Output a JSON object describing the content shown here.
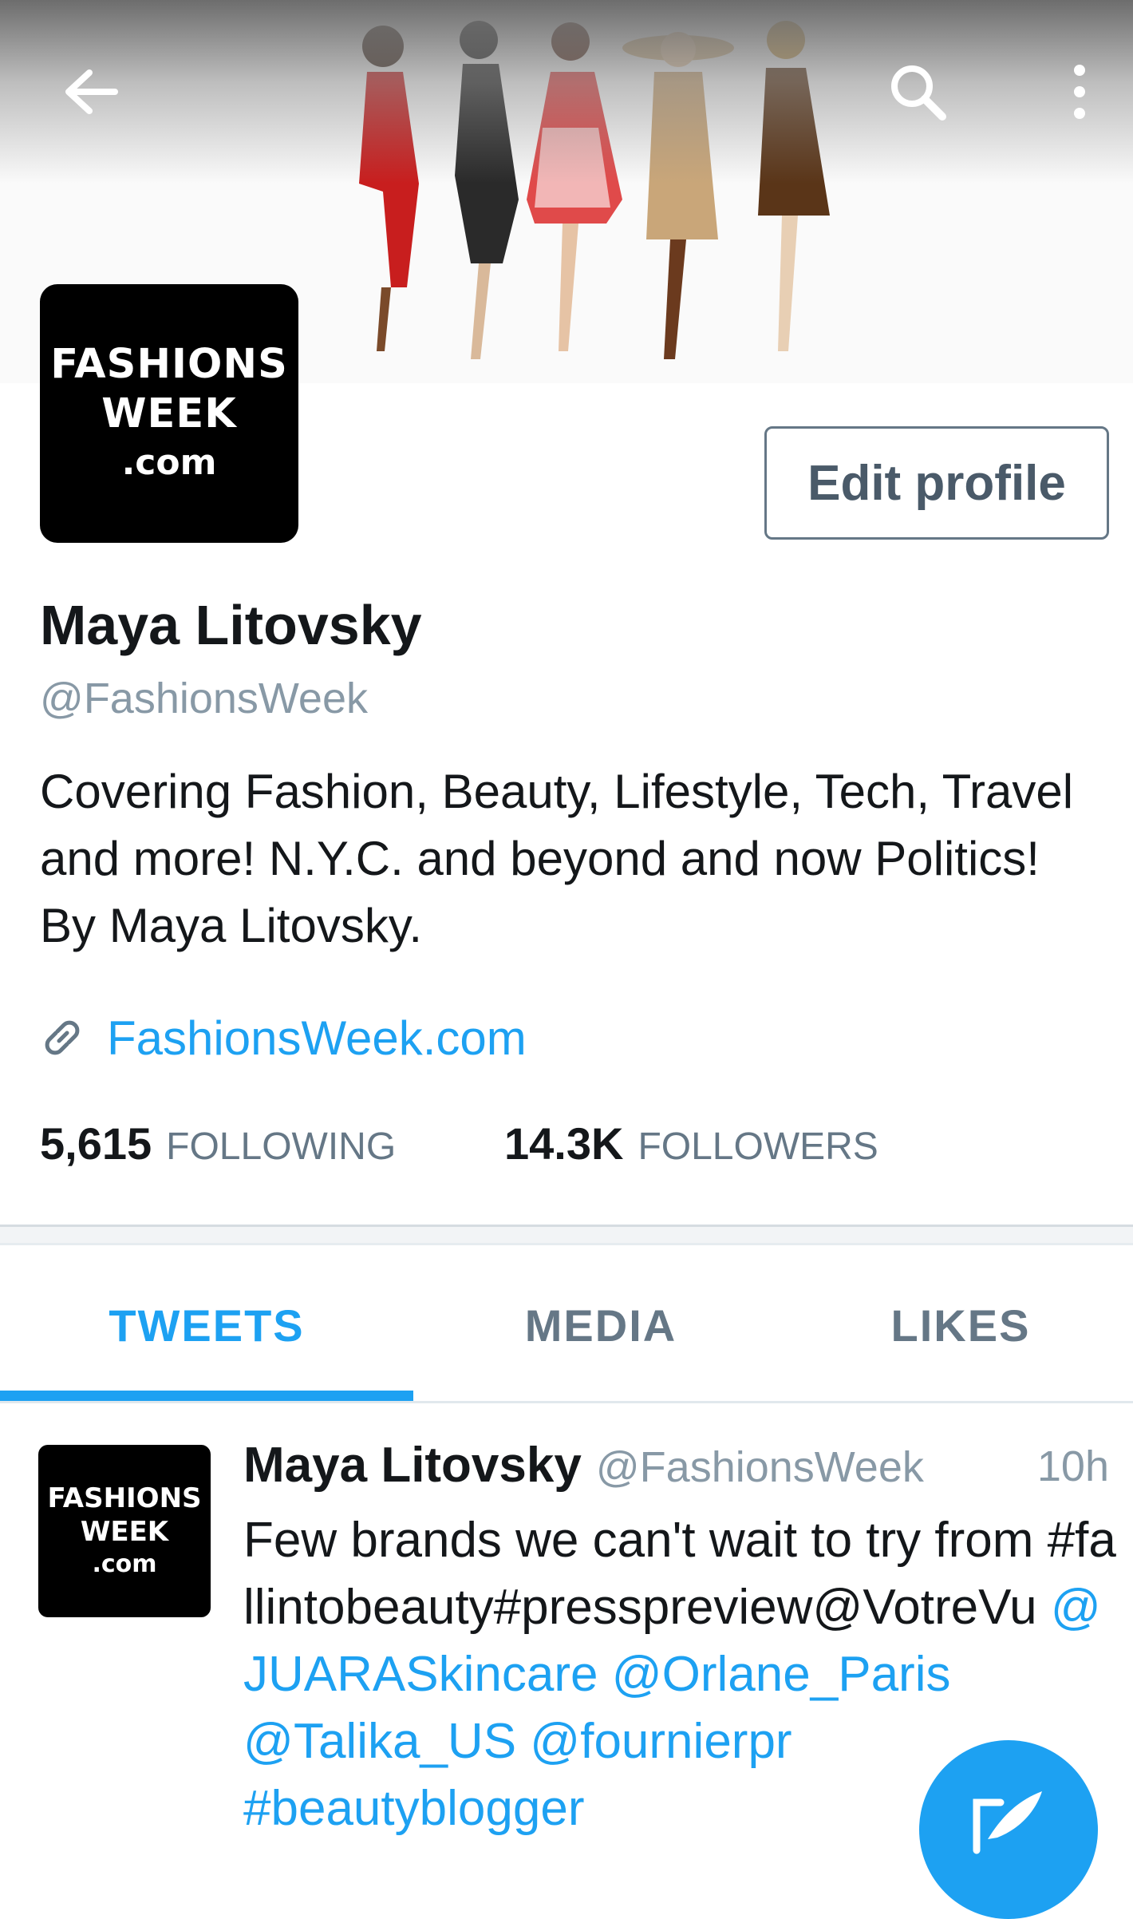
{
  "profile": {
    "avatar_lines": [
      "FASHIONS",
      "WEEK",
      ".com"
    ],
    "edit_label": "Edit profile",
    "name": "Maya Litovsky",
    "handle": "@FashionsWeek",
    "bio_lines": [
      "Covering Fashion, Beauty, Lifestyle, Tech, Travel",
      "and more! N.Y.C. and beyond and now Politics!",
      "By Maya Litovsky."
    ],
    "website": "FashionsWeek.com"
  },
  "stats": {
    "following_count": "5,615",
    "following_label": "FOLLOWING",
    "followers_count": "14.3K",
    "followers_label": "FOLLOWERS"
  },
  "tabs": [
    {
      "label": "TWEETS",
      "active": true
    },
    {
      "label": "MEDIA",
      "active": false
    },
    {
      "label": "LIKES",
      "active": false
    }
  ],
  "tweet": {
    "avatar_lines": [
      "FASHIONS",
      "WEEK",
      ".com"
    ],
    "name": "Maya Litovsky",
    "handle": "@FashionsWeek",
    "time": "10h",
    "text_plain": "Few brands we can't wait to try from #fallintobeauty#presspreview@VotreVu",
    "links_line1": "@JUARASkincare @Orlane_Paris",
    "links_line2": "@Talika_US @fournierpr",
    "links_line3": "#beautyblogger"
  },
  "icons": {
    "back": "arrow-left-icon",
    "search": "search-icon",
    "more": "vertical-dots-icon",
    "link": "link-chain-icon",
    "compose": "compose-quill-icon"
  },
  "colors": {
    "accent": "#1da1f2",
    "secondary_text": "#657786",
    "avatar_bg": "#000000"
  }
}
